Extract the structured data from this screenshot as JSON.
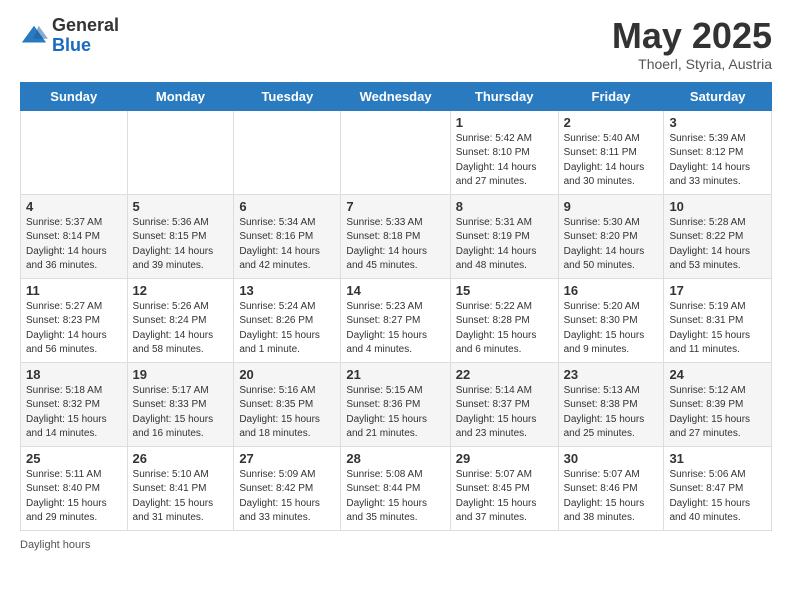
{
  "logo": {
    "general": "General",
    "blue": "Blue"
  },
  "title": "May 2025",
  "subtitle": "Thoerl, Styria, Austria",
  "days_of_week": [
    "Sunday",
    "Monday",
    "Tuesday",
    "Wednesday",
    "Thursday",
    "Friday",
    "Saturday"
  ],
  "footer": "Daylight hours",
  "weeks": [
    [
      {
        "day": "",
        "info": ""
      },
      {
        "day": "",
        "info": ""
      },
      {
        "day": "",
        "info": ""
      },
      {
        "day": "",
        "info": ""
      },
      {
        "day": "1",
        "info": "Sunrise: 5:42 AM\nSunset: 8:10 PM\nDaylight: 14 hours\nand 27 minutes."
      },
      {
        "day": "2",
        "info": "Sunrise: 5:40 AM\nSunset: 8:11 PM\nDaylight: 14 hours\nand 30 minutes."
      },
      {
        "day": "3",
        "info": "Sunrise: 5:39 AM\nSunset: 8:12 PM\nDaylight: 14 hours\nand 33 minutes."
      }
    ],
    [
      {
        "day": "4",
        "info": "Sunrise: 5:37 AM\nSunset: 8:14 PM\nDaylight: 14 hours\nand 36 minutes."
      },
      {
        "day": "5",
        "info": "Sunrise: 5:36 AM\nSunset: 8:15 PM\nDaylight: 14 hours\nand 39 minutes."
      },
      {
        "day": "6",
        "info": "Sunrise: 5:34 AM\nSunset: 8:16 PM\nDaylight: 14 hours\nand 42 minutes."
      },
      {
        "day": "7",
        "info": "Sunrise: 5:33 AM\nSunset: 8:18 PM\nDaylight: 14 hours\nand 45 minutes."
      },
      {
        "day": "8",
        "info": "Sunrise: 5:31 AM\nSunset: 8:19 PM\nDaylight: 14 hours\nand 48 minutes."
      },
      {
        "day": "9",
        "info": "Sunrise: 5:30 AM\nSunset: 8:20 PM\nDaylight: 14 hours\nand 50 minutes."
      },
      {
        "day": "10",
        "info": "Sunrise: 5:28 AM\nSunset: 8:22 PM\nDaylight: 14 hours\nand 53 minutes."
      }
    ],
    [
      {
        "day": "11",
        "info": "Sunrise: 5:27 AM\nSunset: 8:23 PM\nDaylight: 14 hours\nand 56 minutes."
      },
      {
        "day": "12",
        "info": "Sunrise: 5:26 AM\nSunset: 8:24 PM\nDaylight: 14 hours\nand 58 minutes."
      },
      {
        "day": "13",
        "info": "Sunrise: 5:24 AM\nSunset: 8:26 PM\nDaylight: 15 hours\nand 1 minute."
      },
      {
        "day": "14",
        "info": "Sunrise: 5:23 AM\nSunset: 8:27 PM\nDaylight: 15 hours\nand 4 minutes."
      },
      {
        "day": "15",
        "info": "Sunrise: 5:22 AM\nSunset: 8:28 PM\nDaylight: 15 hours\nand 6 minutes."
      },
      {
        "day": "16",
        "info": "Sunrise: 5:20 AM\nSunset: 8:30 PM\nDaylight: 15 hours\nand 9 minutes."
      },
      {
        "day": "17",
        "info": "Sunrise: 5:19 AM\nSunset: 8:31 PM\nDaylight: 15 hours\nand 11 minutes."
      }
    ],
    [
      {
        "day": "18",
        "info": "Sunrise: 5:18 AM\nSunset: 8:32 PM\nDaylight: 15 hours\nand 14 minutes."
      },
      {
        "day": "19",
        "info": "Sunrise: 5:17 AM\nSunset: 8:33 PM\nDaylight: 15 hours\nand 16 minutes."
      },
      {
        "day": "20",
        "info": "Sunrise: 5:16 AM\nSunset: 8:35 PM\nDaylight: 15 hours\nand 18 minutes."
      },
      {
        "day": "21",
        "info": "Sunrise: 5:15 AM\nSunset: 8:36 PM\nDaylight: 15 hours\nand 21 minutes."
      },
      {
        "day": "22",
        "info": "Sunrise: 5:14 AM\nSunset: 8:37 PM\nDaylight: 15 hours\nand 23 minutes."
      },
      {
        "day": "23",
        "info": "Sunrise: 5:13 AM\nSunset: 8:38 PM\nDaylight: 15 hours\nand 25 minutes."
      },
      {
        "day": "24",
        "info": "Sunrise: 5:12 AM\nSunset: 8:39 PM\nDaylight: 15 hours\nand 27 minutes."
      }
    ],
    [
      {
        "day": "25",
        "info": "Sunrise: 5:11 AM\nSunset: 8:40 PM\nDaylight: 15 hours\nand 29 minutes."
      },
      {
        "day": "26",
        "info": "Sunrise: 5:10 AM\nSunset: 8:41 PM\nDaylight: 15 hours\nand 31 minutes."
      },
      {
        "day": "27",
        "info": "Sunrise: 5:09 AM\nSunset: 8:42 PM\nDaylight: 15 hours\nand 33 minutes."
      },
      {
        "day": "28",
        "info": "Sunrise: 5:08 AM\nSunset: 8:44 PM\nDaylight: 15 hours\nand 35 minutes."
      },
      {
        "day": "29",
        "info": "Sunrise: 5:07 AM\nSunset: 8:45 PM\nDaylight: 15 hours\nand 37 minutes."
      },
      {
        "day": "30",
        "info": "Sunrise: 5:07 AM\nSunset: 8:46 PM\nDaylight: 15 hours\nand 38 minutes."
      },
      {
        "day": "31",
        "info": "Sunrise: 5:06 AM\nSunset: 8:47 PM\nDaylight: 15 hours\nand 40 minutes."
      }
    ]
  ]
}
